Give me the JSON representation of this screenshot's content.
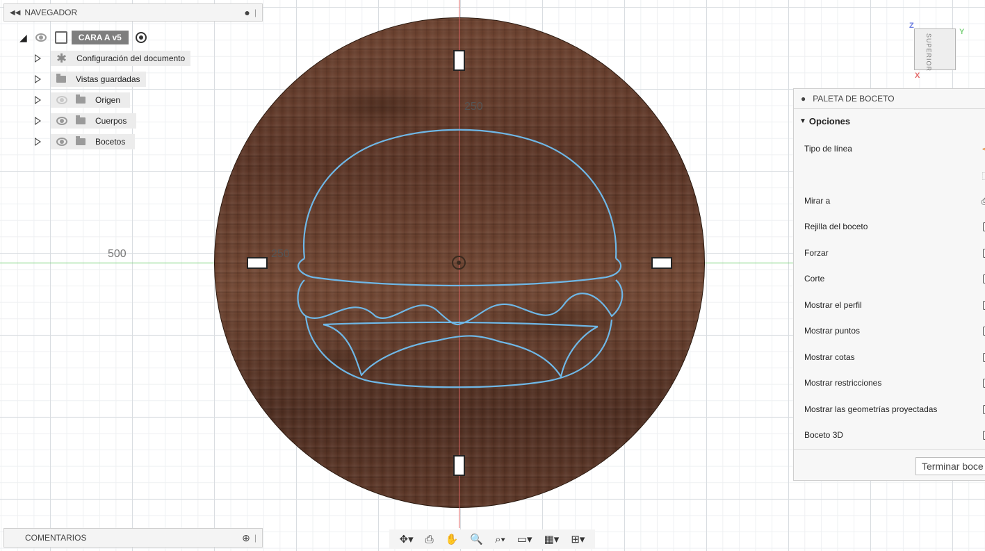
{
  "browser": {
    "title": "NAVEGADOR",
    "root": "CARA A v5",
    "items": [
      {
        "label": "Configuración del documento"
      },
      {
        "label": "Vistas guardadas"
      },
      {
        "label": "Origen"
      },
      {
        "label": "Cuerpos"
      },
      {
        "label": "Bocetos"
      }
    ]
  },
  "canvas": {
    "dimensions": {
      "top": "250",
      "left_inner": "250",
      "left_outer": "500"
    }
  },
  "viewcube": {
    "face": "SUPERIOR",
    "axes": {
      "z": "Z",
      "y": "Y",
      "x": "X"
    }
  },
  "palette": {
    "title": "PALETA DE BOCETO",
    "section": "Opciones",
    "rows": [
      {
        "label": "Tipo de línea",
        "control": "icon"
      },
      {
        "label": "",
        "control": "icon"
      },
      {
        "label": "Mirar a",
        "control": "icon"
      },
      {
        "label": "Rejilla del boceto",
        "checked": true
      },
      {
        "label": "Forzar",
        "checked": false
      },
      {
        "label": "Corte",
        "checked": false
      },
      {
        "label": "Mostrar el perfil",
        "checked": true
      },
      {
        "label": "Mostrar puntos",
        "checked": false
      },
      {
        "label": "Mostrar cotas",
        "checked": true
      },
      {
        "label": "Mostrar restricciones",
        "checked": false
      },
      {
        "label": "Mostrar las geometrías proyectadas",
        "checked": true
      },
      {
        "label": "Boceto 3D",
        "checked": true
      }
    ],
    "finish_label": "Terminar boce"
  },
  "comments": {
    "title": "COMENTARIOS"
  },
  "toolbar": {
    "icons": [
      "orbit-icon",
      "look-at-icon",
      "pan-icon",
      "zoom-icon",
      "zoom-window-icon",
      "display-icon",
      "grid-icon",
      "viewports-icon"
    ]
  },
  "colors": {
    "sketch_line": "#6fb7e6",
    "axis_x": "#6fd06f",
    "axis_y": "#e46a6a"
  }
}
